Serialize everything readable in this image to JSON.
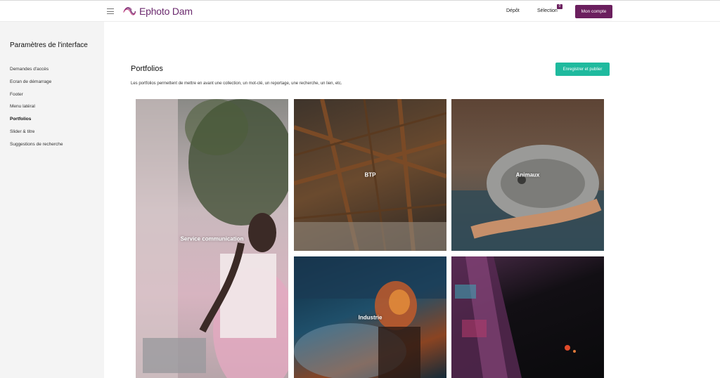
{
  "header": {
    "logo_text": "Ephoto Dam",
    "nav_depot": "Dépôt",
    "nav_selection": "Sélection",
    "selection_count": "0",
    "account_button": "Mon compte"
  },
  "sidebar": {
    "title": "Paramètres de l'interface",
    "items": [
      {
        "label": "Demandes d'accès"
      },
      {
        "label": "Ecran de démarrage"
      },
      {
        "label": "Footer"
      },
      {
        "label": "Menu latéral"
      },
      {
        "label": "Portfolios"
      },
      {
        "label": "Slider & titre"
      },
      {
        "label": "Suggestions de recherche"
      }
    ],
    "active_item": "Portfolios"
  },
  "main": {
    "title": "Portfolios",
    "publish_button": "Enregistrer et publier",
    "description": "Les portfolios permettent de mettre en avant une collection, un mot-clé, un reportage, une recherche, un lien, etc."
  },
  "portfolios": [
    {
      "label": "Service communication"
    },
    {
      "label": "BTP"
    },
    {
      "label": "Animaux"
    },
    {
      "label": "Industrie"
    },
    {
      "label": ""
    }
  ],
  "colors": {
    "brand": "#6b1f5e",
    "accent": "#1fba9e",
    "sidebar_bg": "#f4f4f4"
  }
}
